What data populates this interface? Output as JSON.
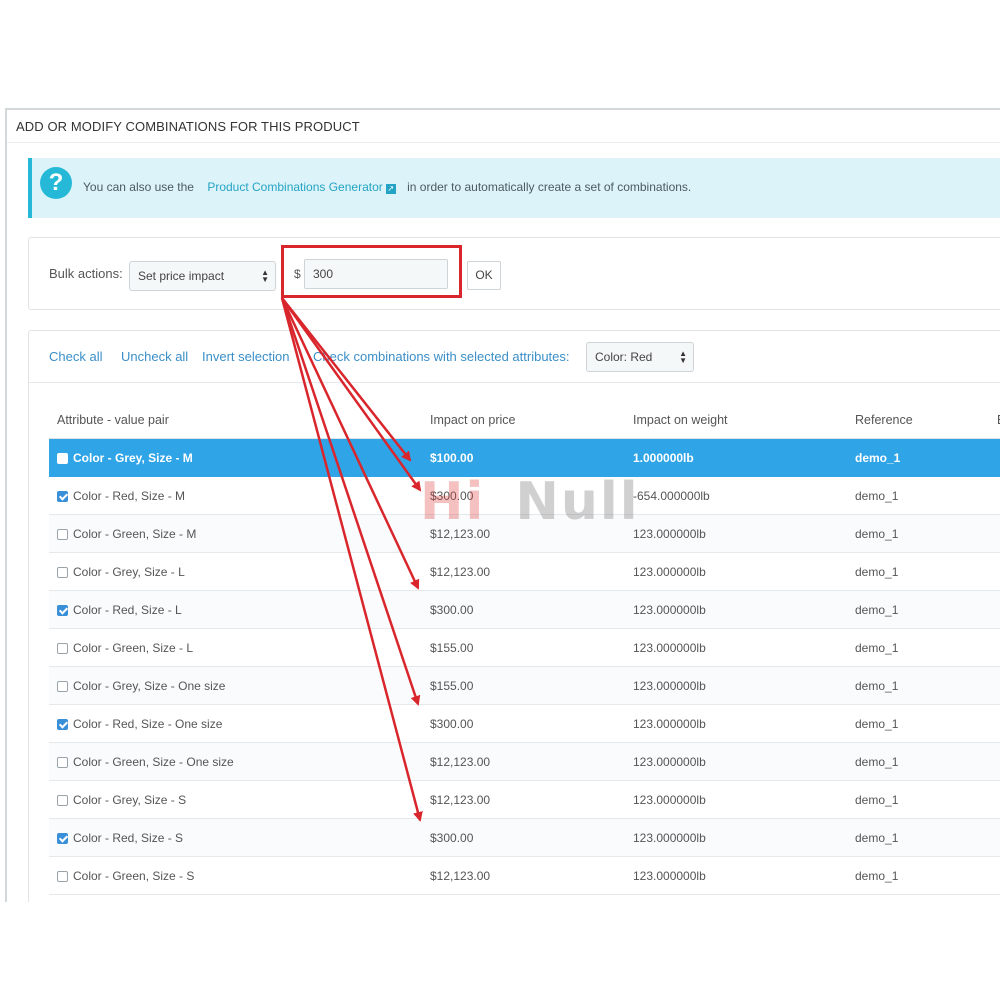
{
  "panel": {
    "title": "ADD OR MODIFY COMBINATIONS FOR THIS PRODUCT"
  },
  "alert": {
    "icon": "question-icon",
    "icon_glyph": "?",
    "text_before": "You can also use the",
    "link_text": "Product Combinations Generator",
    "text_after": "in order to automatically create a set of combinations."
  },
  "bulk": {
    "label": "Bulk actions:",
    "action_selected": "Set price impact",
    "currency": "$",
    "value": "300",
    "ok_label": "OK"
  },
  "toolbar": {
    "check_all": "Check all",
    "uncheck_all": "Uncheck all",
    "invert_selection": "Invert selection",
    "check_with_attr_label": "Check combinations with selected attributes:",
    "attribute_selected": "Color: Red"
  },
  "table": {
    "columns": [
      "Attribute - value pair",
      "Impact on price",
      "Impact on weight",
      "Reference",
      "E"
    ],
    "rows": [
      {
        "attr": "Color - Grey, Size - M",
        "price": "$100.00",
        "weight": "1.000000lb",
        "ref": "demo_1",
        "checked": false,
        "selected": true
      },
      {
        "attr": "Color - Red, Size - M",
        "price": "$300.00",
        "weight": "-654.000000lb",
        "ref": "demo_1",
        "checked": true,
        "selected": false
      },
      {
        "attr": "Color - Green, Size - M",
        "price": "$12,123.00",
        "weight": "123.000000lb",
        "ref": "demo_1",
        "checked": false,
        "selected": false
      },
      {
        "attr": "Color - Grey, Size - L",
        "price": "$12,123.00",
        "weight": "123.000000lb",
        "ref": "demo_1",
        "checked": false,
        "selected": false
      },
      {
        "attr": "Color - Red, Size - L",
        "price": "$300.00",
        "weight": "123.000000lb",
        "ref": "demo_1",
        "checked": true,
        "selected": false
      },
      {
        "attr": "Color - Green, Size - L",
        "price": "$155.00",
        "weight": "123.000000lb",
        "ref": "demo_1",
        "checked": false,
        "selected": false
      },
      {
        "attr": "Color - Grey, Size - One size",
        "price": "$155.00",
        "weight": "123.000000lb",
        "ref": "demo_1",
        "checked": false,
        "selected": false
      },
      {
        "attr": "Color - Red, Size - One size",
        "price": "$300.00",
        "weight": "123.000000lb",
        "ref": "demo_1",
        "checked": true,
        "selected": false
      },
      {
        "attr": "Color - Green, Size - One size",
        "price": "$12,123.00",
        "weight": "123.000000lb",
        "ref": "demo_1",
        "checked": false,
        "selected": false
      },
      {
        "attr": "Color - Grey, Size - S",
        "price": "$12,123.00",
        "weight": "123.000000lb",
        "ref": "demo_1",
        "checked": false,
        "selected": false
      },
      {
        "attr": "Color - Red, Size - S",
        "price": "$300.00",
        "weight": "123.000000lb",
        "ref": "demo_1",
        "checked": true,
        "selected": false
      },
      {
        "attr": "Color - Green, Size - S",
        "price": "$12,123.00",
        "weight": "123.000000lb",
        "ref": "demo_1",
        "checked": false,
        "selected": false
      }
    ]
  },
  "watermark": {
    "text1": "Hi",
    "text2": "Null"
  },
  "colors": {
    "accent": "#25b9d7",
    "link": "#3a8fc8",
    "selected_row": "#2fa4e7",
    "annotation": "#d9262c"
  }
}
